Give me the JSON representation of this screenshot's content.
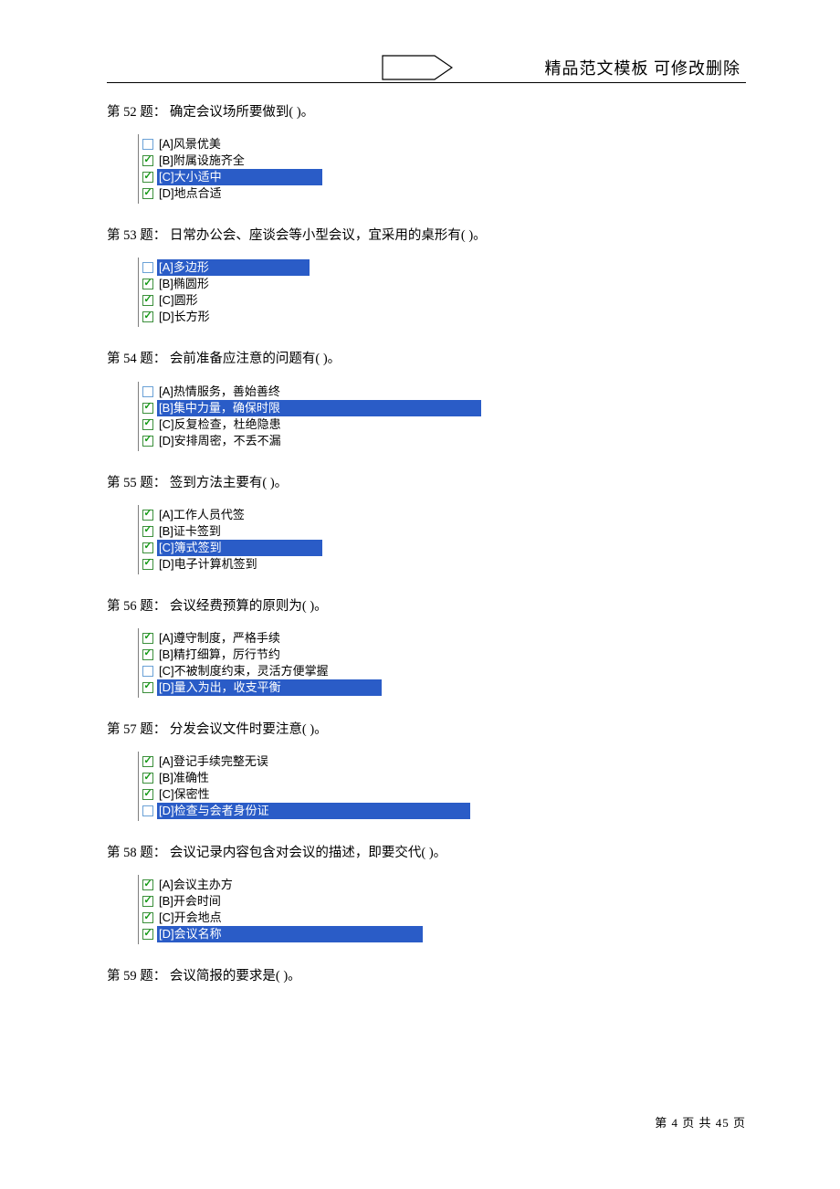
{
  "header": {
    "title": "精品范文模板  可修改删除"
  },
  "footer": {
    "text": "第 4 页 共 45 页"
  },
  "questions": [
    {
      "num": "52",
      "stem": "确定会议场所要做到(  )。",
      "options": [
        {
          "label": "[A]风景优美",
          "checked": false,
          "highlight": false
        },
        {
          "label": "[B]附属设施齐全",
          "checked": true,
          "highlight": false
        },
        {
          "label": "[C]大小适中",
          "checked": true,
          "highlight": true,
          "long": false
        },
        {
          "label": "[D]地点合适",
          "checked": true,
          "highlight": false
        }
      ]
    },
    {
      "num": "53",
      "stem": "日常办公会、座谈会等小型会议，宜采用的桌形有(  )。",
      "options": [
        {
          "label": "[A]多边形",
          "checked": false,
          "highlight": true,
          "long": false
        },
        {
          "label": "[B]椭圆形",
          "checked": true,
          "highlight": false
        },
        {
          "label": "[C]圆形",
          "checked": true,
          "highlight": false
        },
        {
          "label": "[D]长方形",
          "checked": true,
          "highlight": false
        }
      ]
    },
    {
      "num": "54",
      "stem": "会前准备应注意的问题有(  )。",
      "options": [
        {
          "label": "[A]热情服务，善始善终",
          "checked": false,
          "highlight": false
        },
        {
          "label": "[B]集中力量，确保时限",
          "checked": true,
          "highlight": true,
          "long": true
        },
        {
          "label": "[C]反复检查，杜绝隐患",
          "checked": true,
          "highlight": false
        },
        {
          "label": "[D]安排周密，不丢不漏",
          "checked": true,
          "highlight": false
        }
      ]
    },
    {
      "num": "55",
      "stem": "签到方法主要有(  )。",
      "options": [
        {
          "label": "[A]工作人员代签",
          "checked": true,
          "highlight": false
        },
        {
          "label": "[B]证卡签到",
          "checked": true,
          "highlight": false
        },
        {
          "label": "[C]簿式签到",
          "checked": true,
          "highlight": true,
          "long": false
        },
        {
          "label": "[D]电子计算机签到",
          "checked": true,
          "highlight": false
        }
      ]
    },
    {
      "num": "56",
      "stem": "会议经费预算的原则为(  )。",
      "options": [
        {
          "label": "[A]遵守制度，严格手续",
          "checked": true,
          "highlight": false
        },
        {
          "label": "[B]精打细算，厉行节约",
          "checked": true,
          "highlight": false
        },
        {
          "label": "[C]不被制度约束，灵活方便掌握",
          "checked": false,
          "highlight": false
        },
        {
          "label": "[D]量入为出，收支平衡",
          "checked": true,
          "highlight": true,
          "long": false
        }
      ]
    },
    {
      "num": "57",
      "stem": "分发会议文件时要注意(  )。",
      "options": [
        {
          "label": "[A]登记手续完整无误",
          "checked": true,
          "highlight": false
        },
        {
          "label": "[B]准确性",
          "checked": true,
          "highlight": false
        },
        {
          "label": "[C]保密性",
          "checked": true,
          "highlight": false
        },
        {
          "label": "[D]检查与会者身份证",
          "checked": false,
          "highlight": true,
          "long": true
        }
      ]
    },
    {
      "num": "58",
      "stem": "会议记录内容包含对会议的描述，即要交代(  )。",
      "options": [
        {
          "label": "[A]会议主办方",
          "checked": true,
          "highlight": false
        },
        {
          "label": "[B]开会时间",
          "checked": true,
          "highlight": false
        },
        {
          "label": "[C]开会地点",
          "checked": true,
          "highlight": false
        },
        {
          "label": "[D]会议名称",
          "checked": true,
          "highlight": true,
          "long": true
        }
      ]
    },
    {
      "num": "59",
      "stem": "会议简报的要求是(  )。",
      "options": []
    }
  ]
}
